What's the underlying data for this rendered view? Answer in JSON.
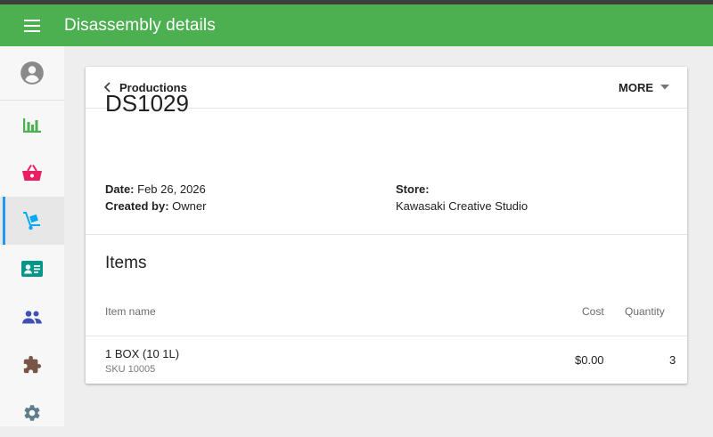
{
  "appbar": {
    "title": "Disassembly details"
  },
  "sidebar": {
    "items": [
      {
        "name": "account",
        "icon": "account-circle-icon",
        "color": "#8a8a8a"
      },
      {
        "name": "reports",
        "icon": "bar-chart-icon",
        "color": "#4caf50"
      },
      {
        "name": "sales",
        "icon": "basket-icon",
        "color": "#e91e63"
      },
      {
        "name": "inventory",
        "icon": "hand-truck-icon",
        "color": "#03a9f4",
        "active": true
      },
      {
        "name": "customers",
        "icon": "contact-card-icon",
        "color": "#009688"
      },
      {
        "name": "employees",
        "icon": "people-icon",
        "color": "#3f51b5"
      },
      {
        "name": "integrations",
        "icon": "puzzle-icon",
        "color": "#795548"
      },
      {
        "name": "settings",
        "icon": "gear-icon",
        "color": "#607d8b"
      }
    ]
  },
  "card": {
    "back_label": "Productions",
    "more_label": "MORE",
    "doc_id": "DS1029",
    "date_label": "Date:",
    "date_value": "Feb 26, 2026",
    "created_label": "Created by:",
    "created_value": "Owner",
    "store_label": "Store:",
    "store_value": "Kawasaki Creative Studio",
    "items_title": "Items",
    "columns": {
      "name": "Item name",
      "cost": "Cost",
      "quantity": "Quantity"
    },
    "rows": [
      {
        "name": "1 BOX (10 1L)",
        "sku": "SKU 10005",
        "cost": "$0.00",
        "quantity": "3"
      }
    ]
  }
}
